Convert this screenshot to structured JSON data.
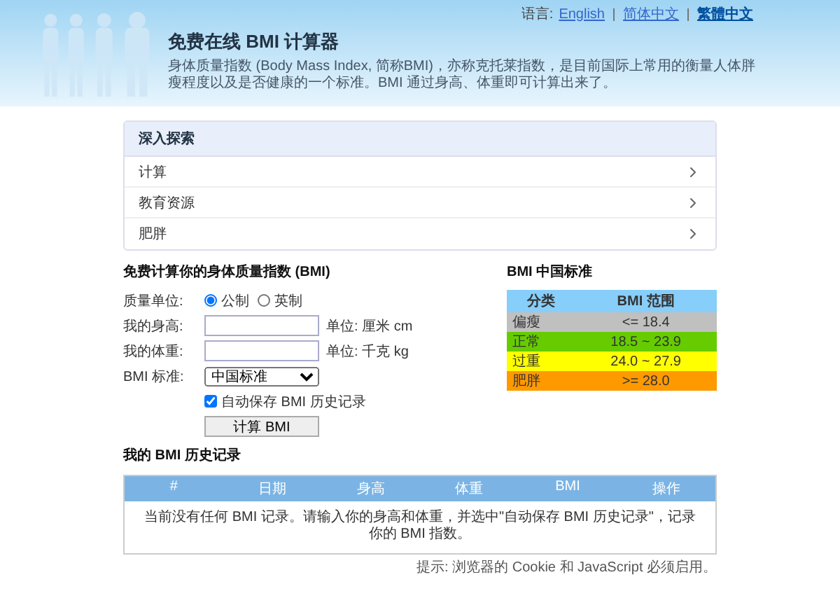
{
  "header": {
    "language_label": "语言:",
    "languages": [
      {
        "label": "English",
        "selected": false
      },
      {
        "label": "简体中文",
        "selected": false
      },
      {
        "label": "繁體中文",
        "selected": true
      }
    ],
    "title": "免费在线 BMI 计算器",
    "description": "身体质量指数 (Body Mass Index, 简称BMI)，亦称克托莱指数，是目前国际上常用的衡量人体胖瘦程度以及是否健康的一个标准。BMI 通过身高、体重即可计算出来了。"
  },
  "explore": {
    "title": "深入探索",
    "items": [
      "计算",
      "教育资源",
      "肥胖"
    ]
  },
  "calculator": {
    "title": "免费计算你的身体质量指数 (BMI)",
    "unit_label": "质量单位:",
    "units": [
      {
        "label": "公制",
        "selected": true
      },
      {
        "label": "英制",
        "selected": false
      }
    ],
    "fields": [
      {
        "label": "我的身高:",
        "unit": "单位: 厘米 cm"
      },
      {
        "label": "我的体重:",
        "unit": "单位: 千克 kg"
      }
    ],
    "standard_label": "BMI 标准:",
    "standard_value": "中国标准",
    "autosave": {
      "label": "自动保存 BMI 历史记录",
      "checked": true
    },
    "button": "计算 BMI"
  },
  "standard_table": {
    "title": "BMI 中国标准",
    "columns": [
      "分类",
      "BMI 范围"
    ],
    "rows": [
      {
        "category": "偏瘦",
        "range": "<= 18.4",
        "color": "#c0c0c0"
      },
      {
        "category": "正常",
        "range": "18.5 ~ 23.9",
        "color": "#66cc00"
      },
      {
        "category": "过重",
        "range": "24.0 ~ 27.9",
        "color": "#ffff00"
      },
      {
        "category": "肥胖",
        "range": ">= 28.0",
        "color": "#ff9900"
      }
    ]
  },
  "history": {
    "title": "我的 BMI 历史记录",
    "columns": [
      "#",
      "日期",
      "身高",
      "体重",
      "BMI",
      "操作"
    ],
    "empty_message": "当前没有任何 BMI 记录。请输入你的身高和体重，并选中\"自动保存 BMI 历史记录\"，记录你的 BMI 指数。"
  },
  "footer_tip": "提示: 浏览器的 Cookie 和 JavaScript 必须启用。"
}
